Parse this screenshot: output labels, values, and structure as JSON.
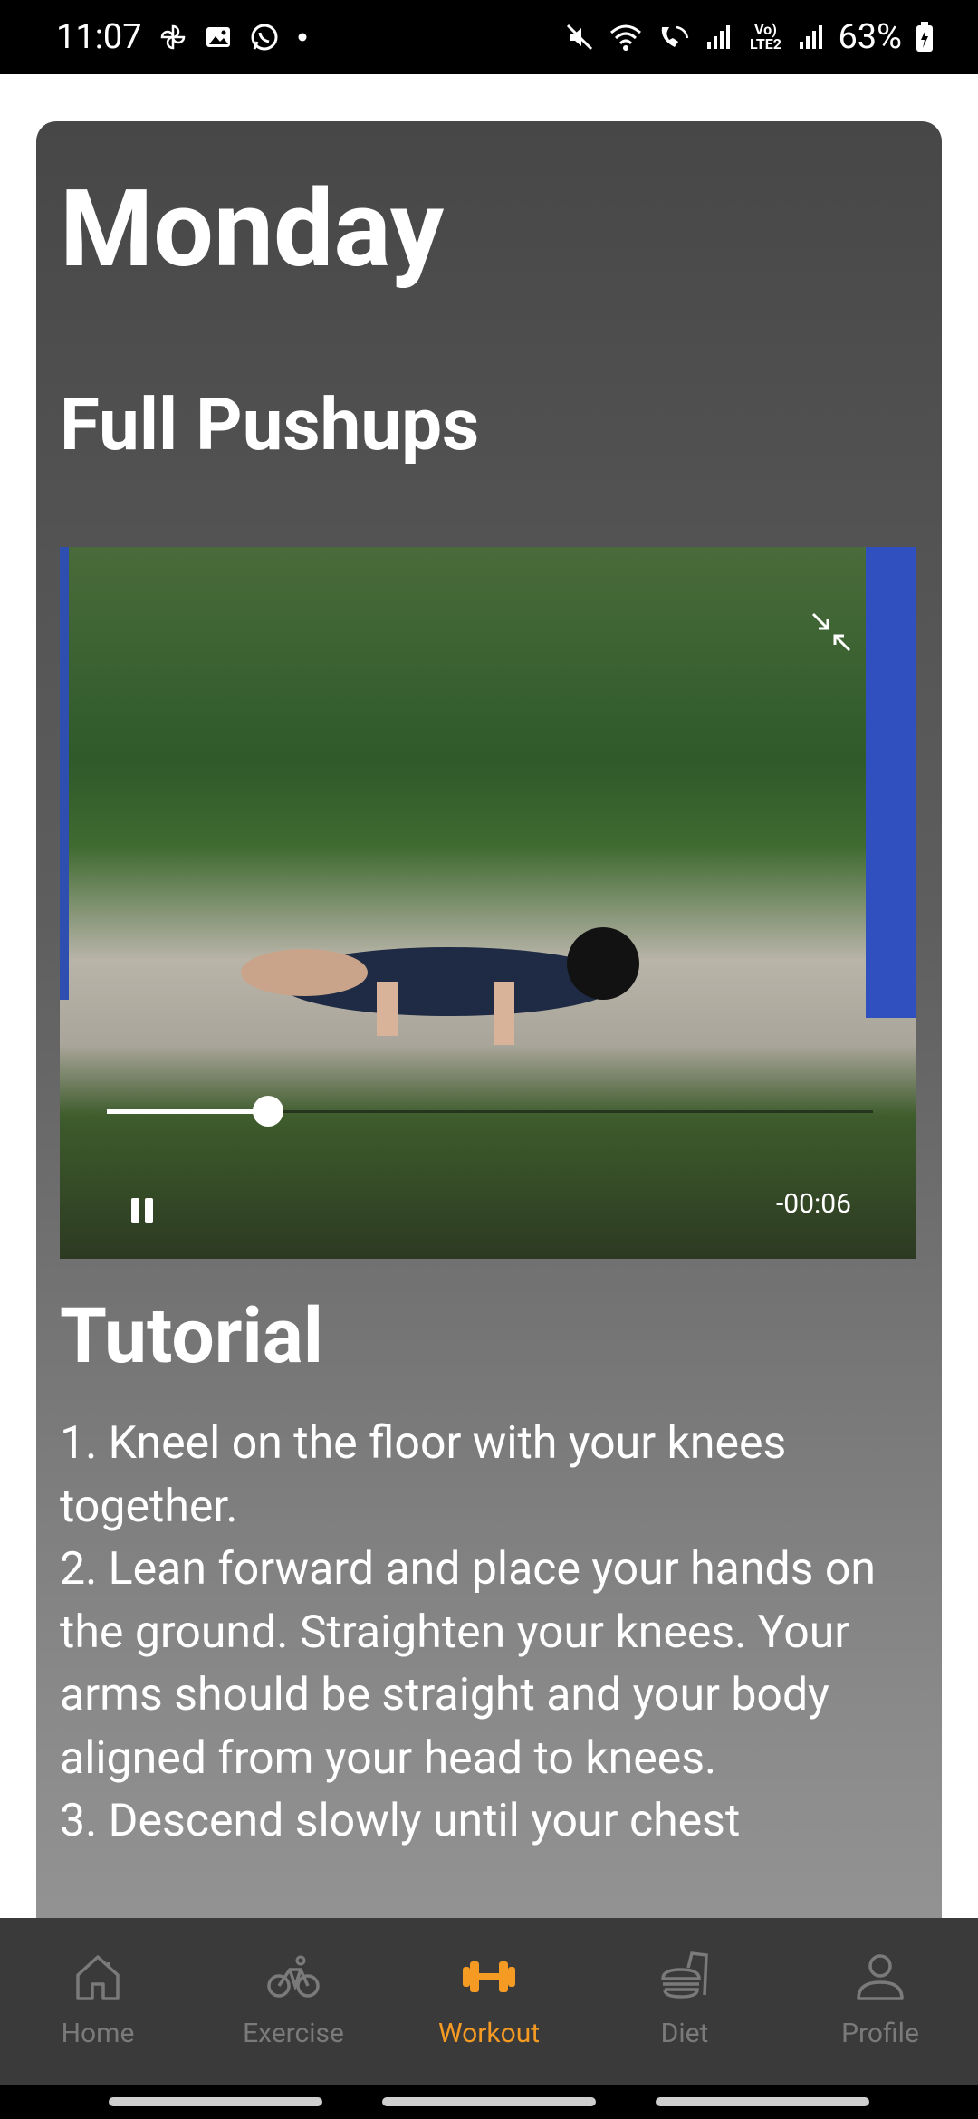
{
  "status_bar": {
    "time": "11:07",
    "battery": "63%",
    "network_label": "Vo) LTE2"
  },
  "workout": {
    "day": "Monday",
    "exercise": "Full Pushups"
  },
  "video": {
    "remaining": "-00:06",
    "progress_fraction": 0.21
  },
  "tutorial": {
    "title": "Tutorial",
    "text": "1. Kneel on the floor with your knees together.\n2. Lean forward and place your hands on the ground. Straighten your knees. Your arms should be straight and your body aligned from your head to knees.\n3. Descend slowly until your chest"
  },
  "nav": {
    "items": [
      {
        "label": "Home",
        "icon": "home-icon"
      },
      {
        "label": "Exercise",
        "icon": "bicycle-icon"
      },
      {
        "label": "Workout",
        "icon": "dumbbell-icon"
      },
      {
        "label": "Diet",
        "icon": "food-icon"
      },
      {
        "label": "Profile",
        "icon": "person-icon"
      }
    ],
    "active_index": 2,
    "active_color": "#f59a23",
    "inactive_color": "#7a7a7a"
  }
}
